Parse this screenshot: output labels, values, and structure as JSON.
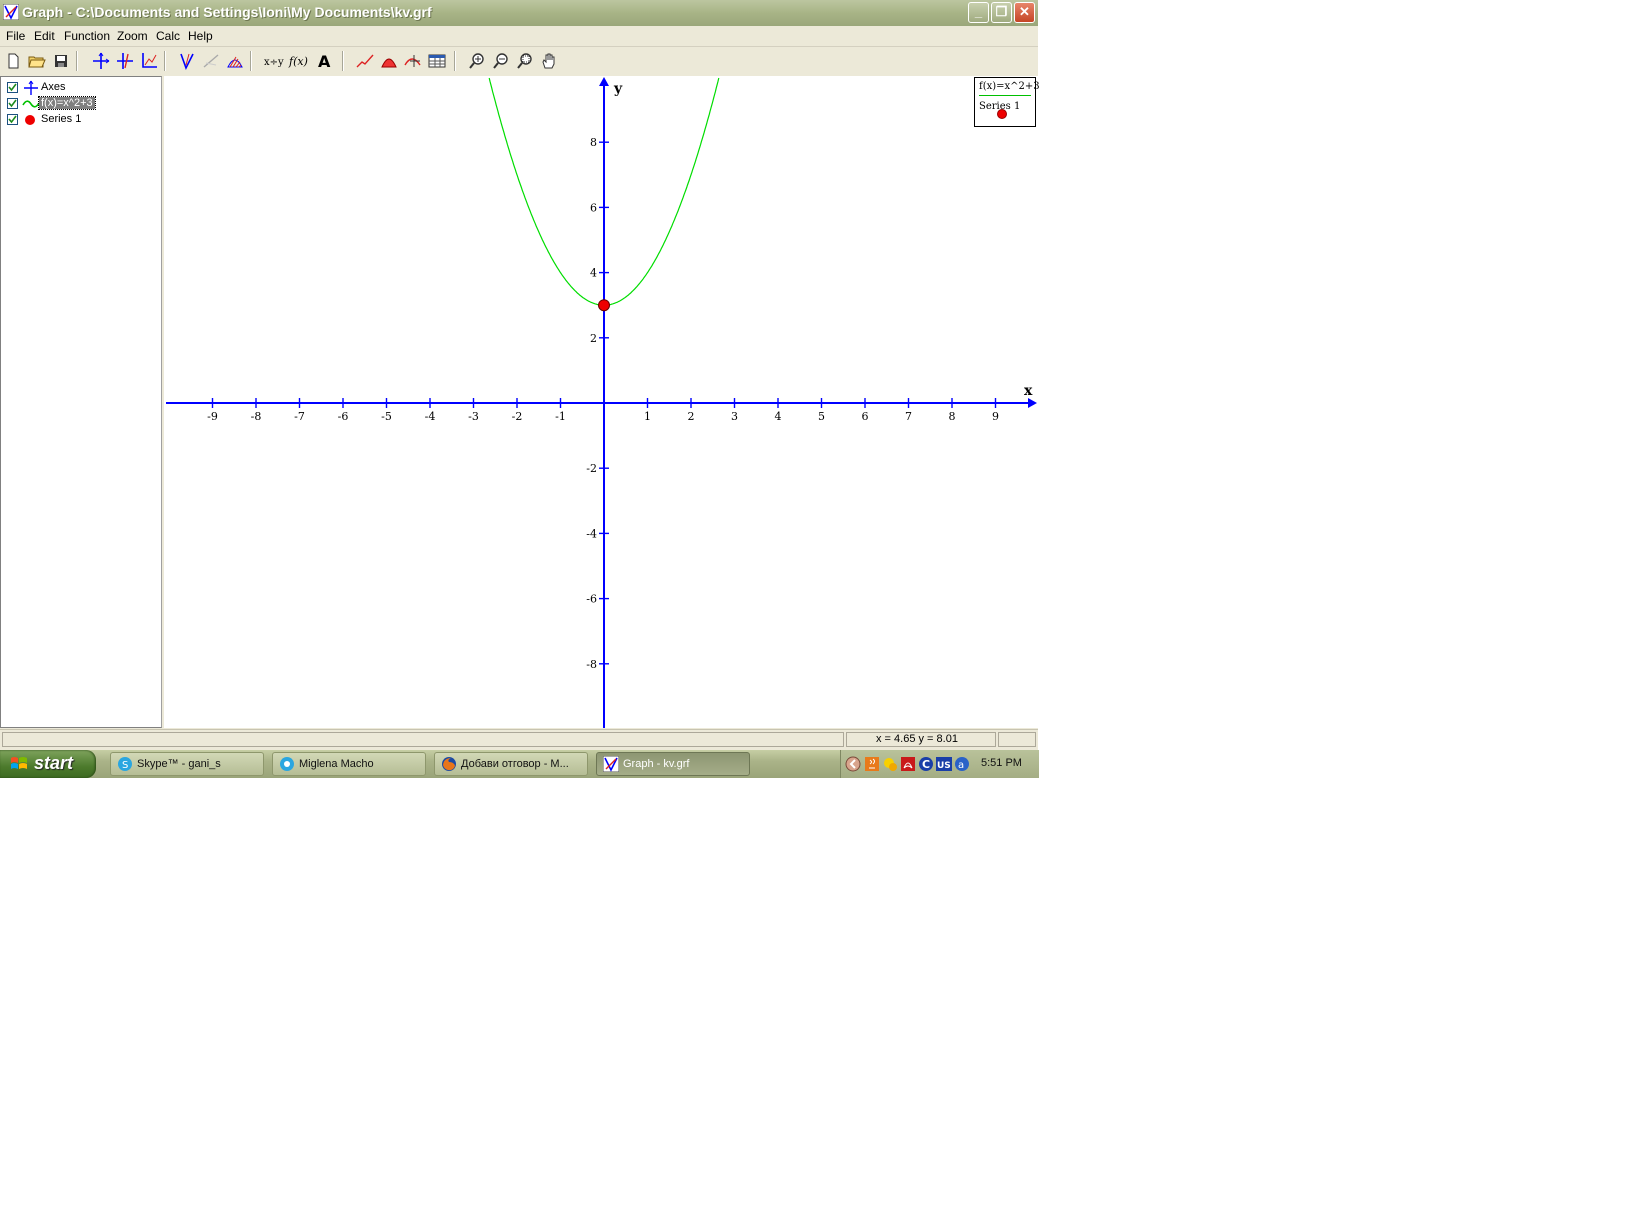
{
  "window": {
    "title": "Graph - C:\\Documents and Settings\\Ioni\\My Documents\\kv.grf",
    "minimize_glyph": "_",
    "maximize_glyph": "❐",
    "close_glyph": "✕"
  },
  "menu": [
    "File",
    "Edit",
    "Function",
    "Zoom",
    "Calc",
    "Help"
  ],
  "toolbar": {
    "icons": [
      "new-file-icon",
      "open-folder-icon",
      "save-icon",
      "axes-icon",
      "axes-insert-icon",
      "coordinate-system-icon",
      "insert-function-icon",
      "tangent-icon",
      "shading-icon",
      "point-series-icon",
      "function-fx-icon",
      "text-label-icon",
      "trendline-icon",
      "area-icon",
      "evaluate-icon",
      "table-icon",
      "zoom-in-icon",
      "zoom-out-icon",
      "zoom-square-icon",
      "hand-pan-icon"
    ],
    "xy_glyph": "x÷y",
    "fx_glyph": "f(x)",
    "text_glyph": "A"
  },
  "tree": [
    {
      "label": "Axes",
      "checked": true,
      "icon": "axes-icon"
    },
    {
      "label": "f(x)=x^2+3",
      "checked": true,
      "icon": "green-curve-icon",
      "selected": true
    },
    {
      "label": "Series 1",
      "checked": true,
      "icon": "red-dot-icon"
    }
  ],
  "legend": {
    "function_label": "f(x)=x^2+3",
    "series_label": "Series 1"
  },
  "status": {
    "coords": "x = 4.65   y = 8.01"
  },
  "taskbar": {
    "start_label": "start",
    "tasks": [
      {
        "label": "Skype™ - gani_s",
        "icon": "skype-icon",
        "active": false
      },
      {
        "label": "Miglena Macho",
        "icon": "skype-chat-icon",
        "active": false
      },
      {
        "label": "Добави отговор - M...",
        "icon": "firefox-icon",
        "active": false
      },
      {
        "label": "Graph - kv.grf",
        "icon": "graph-app-icon",
        "active": true
      }
    ],
    "clock": "5:51 PM",
    "tray_icons": [
      "tray-arrow-icon",
      "java-icon",
      "messenger-icon",
      "acrobat-icon",
      "c-icon",
      "language-us-icon",
      "agent-icon"
    ]
  },
  "colors": {
    "axes": "#0000ff",
    "function": "#00dd00",
    "series_point": "#ee0000"
  },
  "chart_data": {
    "type": "line",
    "function": "f(x)=x^2+3",
    "x_axis_label": "x",
    "y_axis_label": "y",
    "xlim": [
      -10,
      10
    ],
    "ylim": [
      -10,
      10
    ],
    "x_ticks": [
      -9,
      -8,
      -7,
      -6,
      -5,
      -4,
      -3,
      -2,
      -1,
      1,
      2,
      3,
      4,
      5,
      6,
      7,
      8,
      9
    ],
    "y_ticks": [
      8,
      6,
      4,
      2,
      -2,
      -4,
      -6,
      -8
    ],
    "series": [
      {
        "name": "f(x)=x^2+3",
        "kind": "curve",
        "color": "#00dd00"
      },
      {
        "name": "Series 1",
        "kind": "points",
        "points": [
          {
            "x": 0,
            "y": 3
          }
        ],
        "color": "#ee0000"
      }
    ]
  }
}
